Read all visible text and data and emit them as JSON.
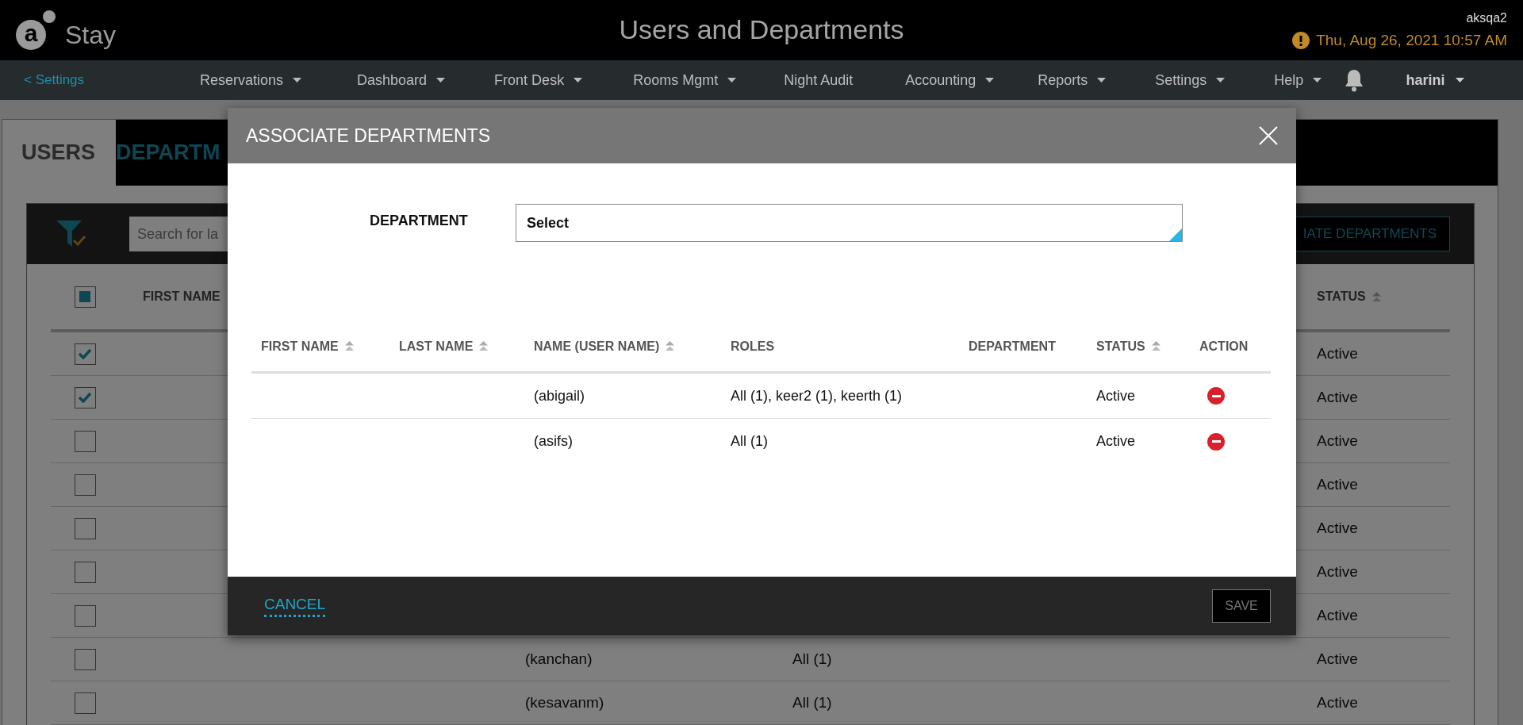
{
  "header": {
    "logo_mark": "a",
    "logo_text": "Stay",
    "title": "Users and Departments",
    "user": "aksqa2",
    "datetime": "Thu, Aug 26, 2021 10:57 AM"
  },
  "nav": {
    "back": "< Settings",
    "items": [
      {
        "label": "Reservations",
        "has_menu": true
      },
      {
        "label": "Dashboard",
        "has_menu": true
      },
      {
        "label": "Front Desk",
        "has_menu": true
      },
      {
        "label": "Rooms Mgmt",
        "has_menu": true
      },
      {
        "label": "Night Audit",
        "has_menu": false
      },
      {
        "label": "Accounting",
        "has_menu": true
      },
      {
        "label": "Reports",
        "has_menu": true
      },
      {
        "label": "Settings",
        "has_menu": true
      },
      {
        "label": "Help",
        "has_menu": true
      }
    ],
    "user": "harini"
  },
  "page": {
    "tabs": [
      {
        "label": "USERS",
        "selected": true
      },
      {
        "label": "DEPARTM",
        "selected": false
      }
    ],
    "search": {
      "placeholder": "Search for la"
    },
    "associate_button": "IATE DEPARTMENTS",
    "columns": {
      "first": "FIRST NAME",
      "status": "STATUS"
    },
    "select_all": {
      "indeterminate": true
    },
    "rows": [
      {
        "checked": true,
        "status": "Active"
      },
      {
        "checked": true,
        "status": "Active"
      },
      {
        "checked": false,
        "status": "Active"
      },
      {
        "checked": false,
        "status": "Active"
      },
      {
        "checked": false,
        "status": "Active"
      },
      {
        "checked": false,
        "status": "Active"
      },
      {
        "checked": false,
        "status": "Active"
      },
      {
        "checked": false,
        "name": "(kanchan)",
        "roles": "All (1)",
        "status": "Active"
      },
      {
        "checked": false,
        "name": "(kesavanm)",
        "roles": "All (1)",
        "status": "Active"
      }
    ]
  },
  "modal": {
    "title": "ASSOCIATE DEPARTMENTS",
    "department_label": "DEPARTMENT",
    "department_value": "Select",
    "columns": [
      {
        "label": "FIRST NAME",
        "sortable": true
      },
      {
        "label": "LAST NAME",
        "sortable": true
      },
      {
        "label": "NAME (USER NAME)",
        "sortable": true
      },
      {
        "label": "ROLES",
        "sortable": false
      },
      {
        "label": "DEPARTMENT",
        "sortable": false
      },
      {
        "label": "STATUS",
        "sortable": true
      },
      {
        "label": "ACTION",
        "sortable": false
      }
    ],
    "rows": [
      {
        "name": "(abigail)",
        "roles": "All (1), keer2 (1), keerth (1)",
        "status": "Active"
      },
      {
        "name": "(asifs)",
        "roles": "All (1)",
        "status": "Active"
      }
    ],
    "cancel": "CANCEL",
    "save": {
      "label": "SAVE",
      "disabled": true
    }
  }
}
